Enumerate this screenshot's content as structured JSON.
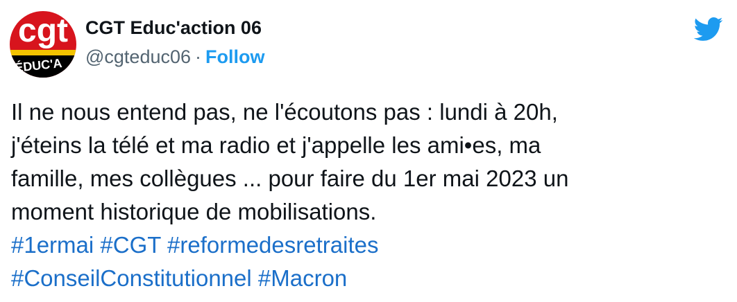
{
  "author": {
    "display_name": "CGT Educ'action 06",
    "handle": "@cgteduc06",
    "separator": "·",
    "follow_label": "Follow",
    "avatar_logo_text": "cgt",
    "avatar_sub_text": "ÉDUC'A"
  },
  "tweet": {
    "line1": "Il ne nous entend pas, ne l'écoutons pas : lundi à 20h,",
    "line2": "j'éteins la télé et ma radio et j'appelle les ami•es, ma",
    "line3": "famille, mes collègues ... pour faire du 1er mai 2023 un",
    "line4": "moment historique de mobilisations.",
    "hashtags_line1": [
      "#1ermai",
      "#CGT",
      "#reformedesretraites"
    ],
    "hashtags_line2": [
      "#ConseilConstitutionnel",
      "#Macron"
    ]
  },
  "icons": {
    "brand": "twitter-bird-icon"
  },
  "colors": {
    "link": "#1b6fc9",
    "follow": "#1d9bf0",
    "text": "#0f1419",
    "secondary": "#536471",
    "logo_red": "#d7141d",
    "logo_yellow": "#f3c300"
  }
}
